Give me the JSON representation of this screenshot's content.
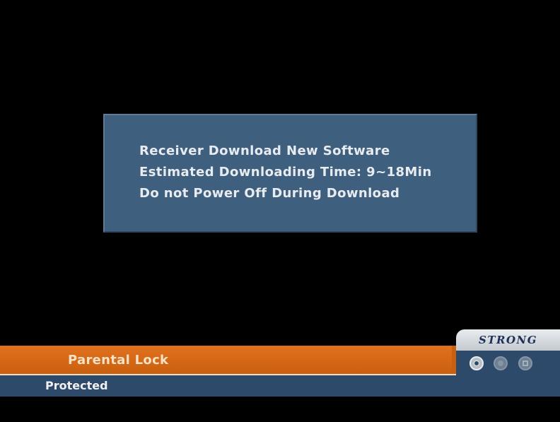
{
  "dialog": {
    "lines": [
      "Receiver Download New Software",
      "Estimated Downloading Time: 9~18Min",
      "Do not Power Off During Download"
    ]
  },
  "info_bar": {
    "channel_name": "Parental Lock",
    "status": "Protected"
  },
  "brand": {
    "name": "STRONG"
  },
  "icons": [
    "signal-icon",
    "audio-icon",
    "subtitle-icon"
  ],
  "colors": {
    "background": "#000000",
    "dialog": "#3f5f7e",
    "orange_bar": "#d8681a",
    "blue_bar": "#2e4a6b",
    "brand_panel": "#d8dde3"
  }
}
